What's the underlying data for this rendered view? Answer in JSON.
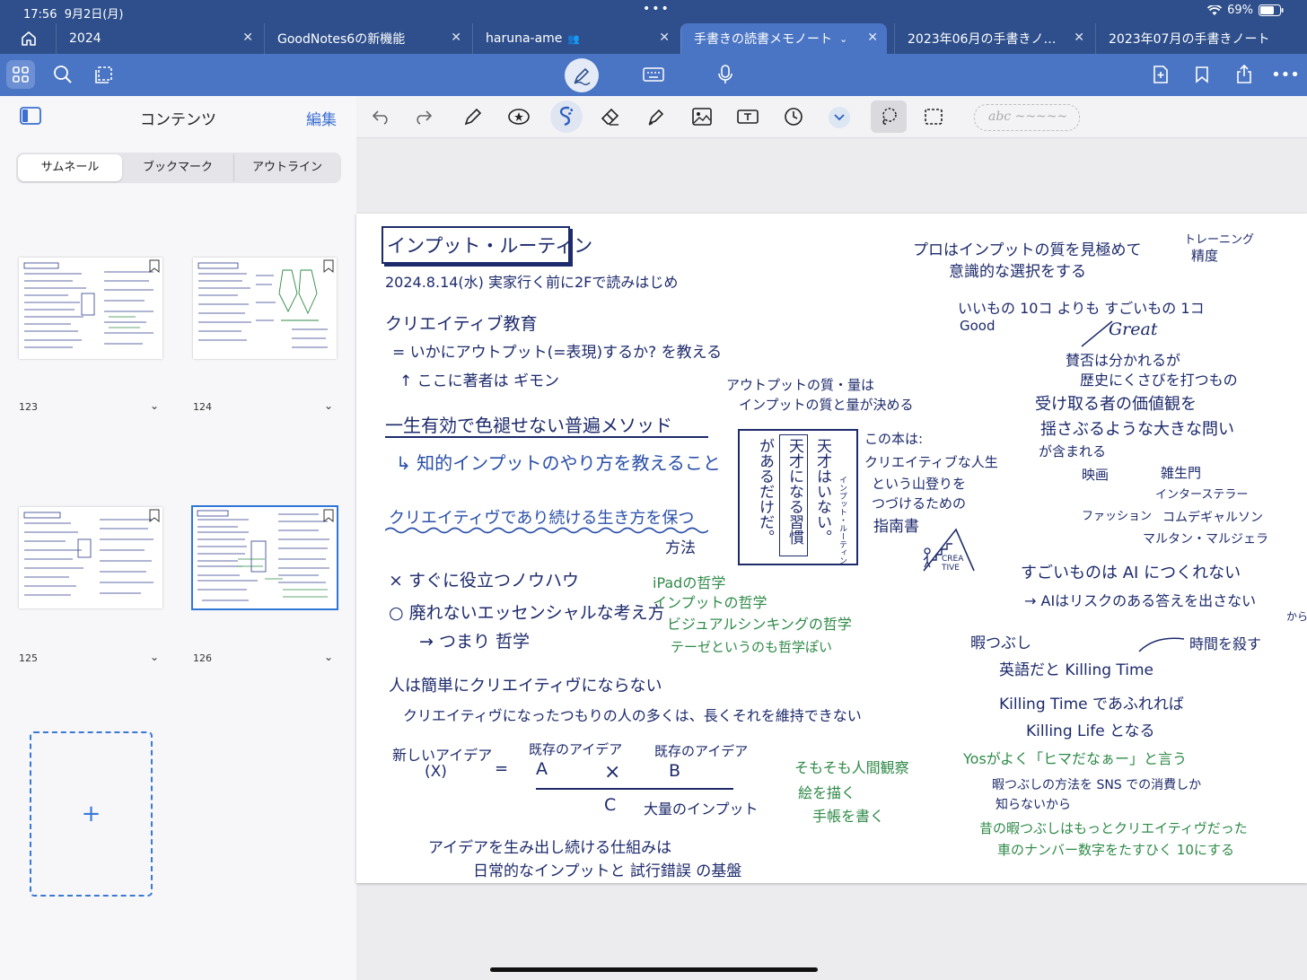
{
  "status": {
    "time": "17:56",
    "date": "9月2日(月)",
    "battery": "69%"
  },
  "tabs": [
    {
      "label": "2024"
    },
    {
      "label": "GoodNotes6の新機能"
    },
    {
      "label": "haruna-ame"
    },
    {
      "label": "手書きの読書メモノート"
    },
    {
      "label": "2023年06月の手書きノ…"
    },
    {
      "label": "2023年07月の手書きノート"
    }
  ],
  "sidebar": {
    "title": "コンテンツ",
    "edit": "編集",
    "segments": [
      "サムネール",
      "ブックマーク",
      "アウトライン"
    ],
    "pages": [
      "123",
      "124",
      "125",
      "126"
    ]
  },
  "text_box_placeholder": "abc ~~~~~",
  "note": {
    "title": "インプット・ルーティン",
    "date": "2024.8.14(水) 実家行く前に2Fで読みはじめ",
    "l1": "クリエイティブ教育",
    "l2": "= いかにアウトプット(=表現)するか? を教える",
    "l3": "↑ ここに著者は ギモン",
    "l4": "一生有効で色褪せない普遍メソッド",
    "l5": "↳ 知的インプットのやり方を教えること",
    "l6": "クリエイティヴであり続ける生き方を保つ",
    "l6b": "方法",
    "l7": "× すぐに役立つノウハウ",
    "l8": "○ 廃れないエッセンシャルな考え方",
    "l9": "→ つまり 哲学",
    "g1": "iPadの哲学",
    "g2": "インプットの哲学",
    "g3": "ビジュアルシンキングの哲学",
    "g4": "テーゼというのも哲学ぽい",
    "l10": "人は簡単にクリエイティヴにならない",
    "l11": "クリエイティヴになったつもりの人の多くは、長くそれを維持できない",
    "f1": "新しいアイデア",
    "f1b": "(X)",
    "f2": "既存のアイデア",
    "f2b": "A",
    "f3": "既存のアイデア",
    "f3b": "B",
    "fx": "×",
    "feq": "=",
    "fc": "C",
    "fc2": "大量のインプット",
    "l12": "アイデアを生み出し続ける仕組みは",
    "l13": "日常的なインプットと 試行錯誤 の基盤",
    "c1": "アウトプットの質・量は",
    "c2": "インプットの質と量が決める",
    "book1": "天才はいない。",
    "book2": "天才になる習慣",
    "book3": "があるだけだ。",
    "book4": "インプット・ルーティン",
    "b1": "この本は:",
    "b2": "クリエイティブな人生",
    "b3": "という山登りを",
    "b4": "つづけるための",
    "b5": "指南書",
    "create": "CREA TIVE",
    "g5": "そもそも人間観察",
    "g6": "絵を描く",
    "g7": "手帳を書く",
    "r1": "プロはインプットの質を見極めて",
    "r2": "意識的な選択をする",
    "r3": "トレーニング",
    "r3b": "精度",
    "r4": "いいもの 10コ よりも すごいもの 1コ",
    "r4a": "Good",
    "r5": "Great",
    "r6": "賛否は分かれるが",
    "r7": "歴史にくさびを打つもの",
    "r8": "受け取る者の価値観を",
    "r9": "揺さぶるような大きな問い",
    "r10": "が含まれる",
    "r11": "映画",
    "r11b": "雑生門",
    "r11c": "インターステラー",
    "r12": "ファッション",
    "r12b": "コムデギャルソン",
    "r12c": "マルタン・マルジェラ",
    "r13": "すごいものは AI につくれない",
    "r14": "→ AIはリスクのある答えを出さない",
    "r14b": "から",
    "r15": "暇つぶし",
    "r15b": "時間を殺す",
    "r16": "英語だと Killing Time",
    "r17": "Killing Time であふれれば",
    "r18": "Killing Life となる",
    "r19": "Yosがよく「ヒマだなぁー」と言う",
    "gr1": "暇つぶしの方法を SNS での消費しか",
    "gr2": "知らないから",
    "gr3": "昔の暇つぶしはもっとクリエイティヴだった",
    "gr4": "車のナンバー数字をたすひく 10にする"
  },
  "colors": {
    "chrome": "#2e4f8c",
    "toolbar": "#4a74c4",
    "accent": "#3b6fd1",
    "ink": "#1d2a6b",
    "ink_green": "#2f8a48"
  }
}
